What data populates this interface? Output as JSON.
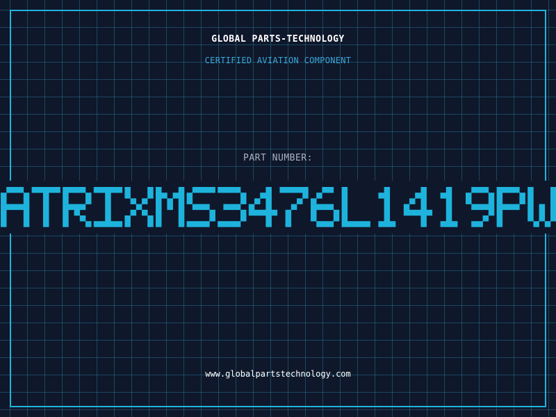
{
  "header": {
    "company_name": "GLOBAL PARTS-TECHNOLOGY",
    "tagline": "CERTIFIED AVIATION COMPONENT"
  },
  "part": {
    "label": "PART NUMBER:",
    "number": "ATRIXMS3476L1419PW"
  },
  "footer": {
    "website": "www.globalpartstechnology.com"
  },
  "colors": {
    "background": "#0f172a",
    "grid": "#22708c",
    "frame": "#22b3dc",
    "accent": "#1eb3dc",
    "tagline": "#3aa6d6",
    "label": "#aab4c4",
    "text": "#ffffff"
  }
}
